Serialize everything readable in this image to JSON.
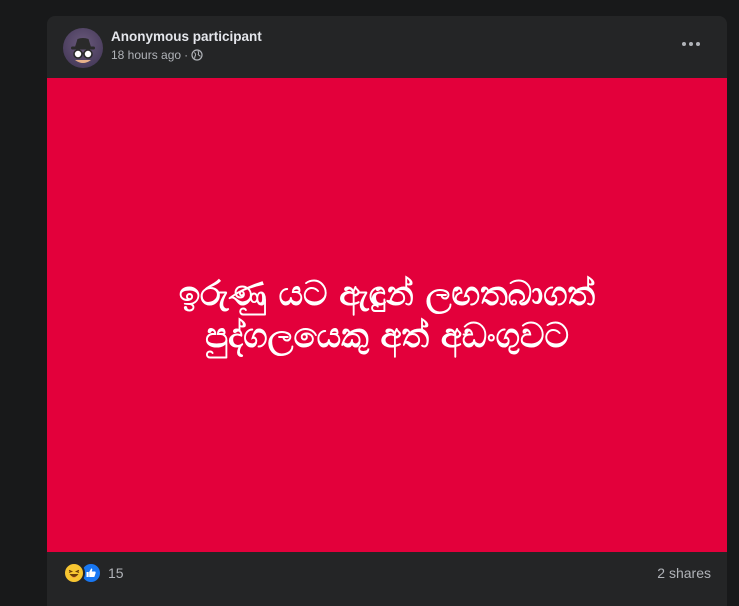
{
  "post": {
    "author": "Anonymous participant",
    "time": "18 hours ago",
    "separator": "·",
    "privacy_icon": "globe-icon",
    "menu_icon": "more-options-icon",
    "card": {
      "background": "#e3003b",
      "line1": "ඉරුණු යට ඇඳුන් ලඟතබාගත්",
      "line2": "පුද්ගලයෙකු අත් අඩංගුවට"
    },
    "reactions": {
      "icons": [
        "haha-reaction-icon",
        "like-reaction-icon"
      ],
      "count": "15"
    },
    "shares": "2 shares"
  }
}
